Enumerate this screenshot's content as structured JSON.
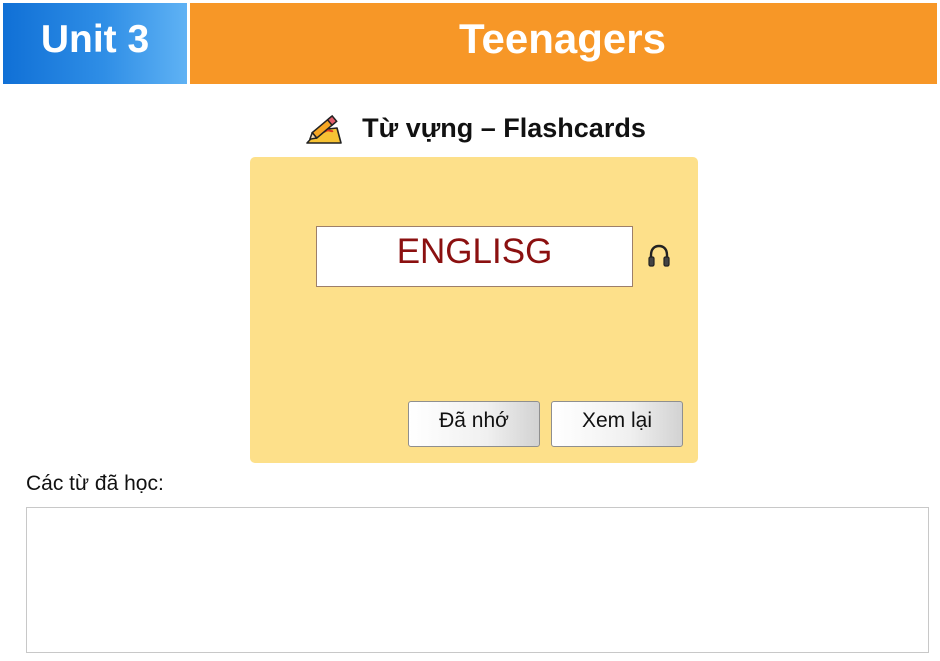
{
  "header": {
    "unit_label": "Unit 3",
    "title": "Teenagers",
    "unit_colors": [
      "#1070d6",
      "#5fb2f4"
    ],
    "title_color": "#f79727"
  },
  "section": {
    "icon": "pencil-writing-icon",
    "title": "Từ vựng – Flashcards"
  },
  "flashcard": {
    "background_color": "#fde08a",
    "word": "ENGLISG",
    "word_color": "#8b1010",
    "audio_icon": "headphones-icon",
    "remembered_button": "Đã nhớ",
    "review_button": "Xem lại"
  },
  "learned": {
    "label": "Các từ đã học:",
    "items": []
  }
}
